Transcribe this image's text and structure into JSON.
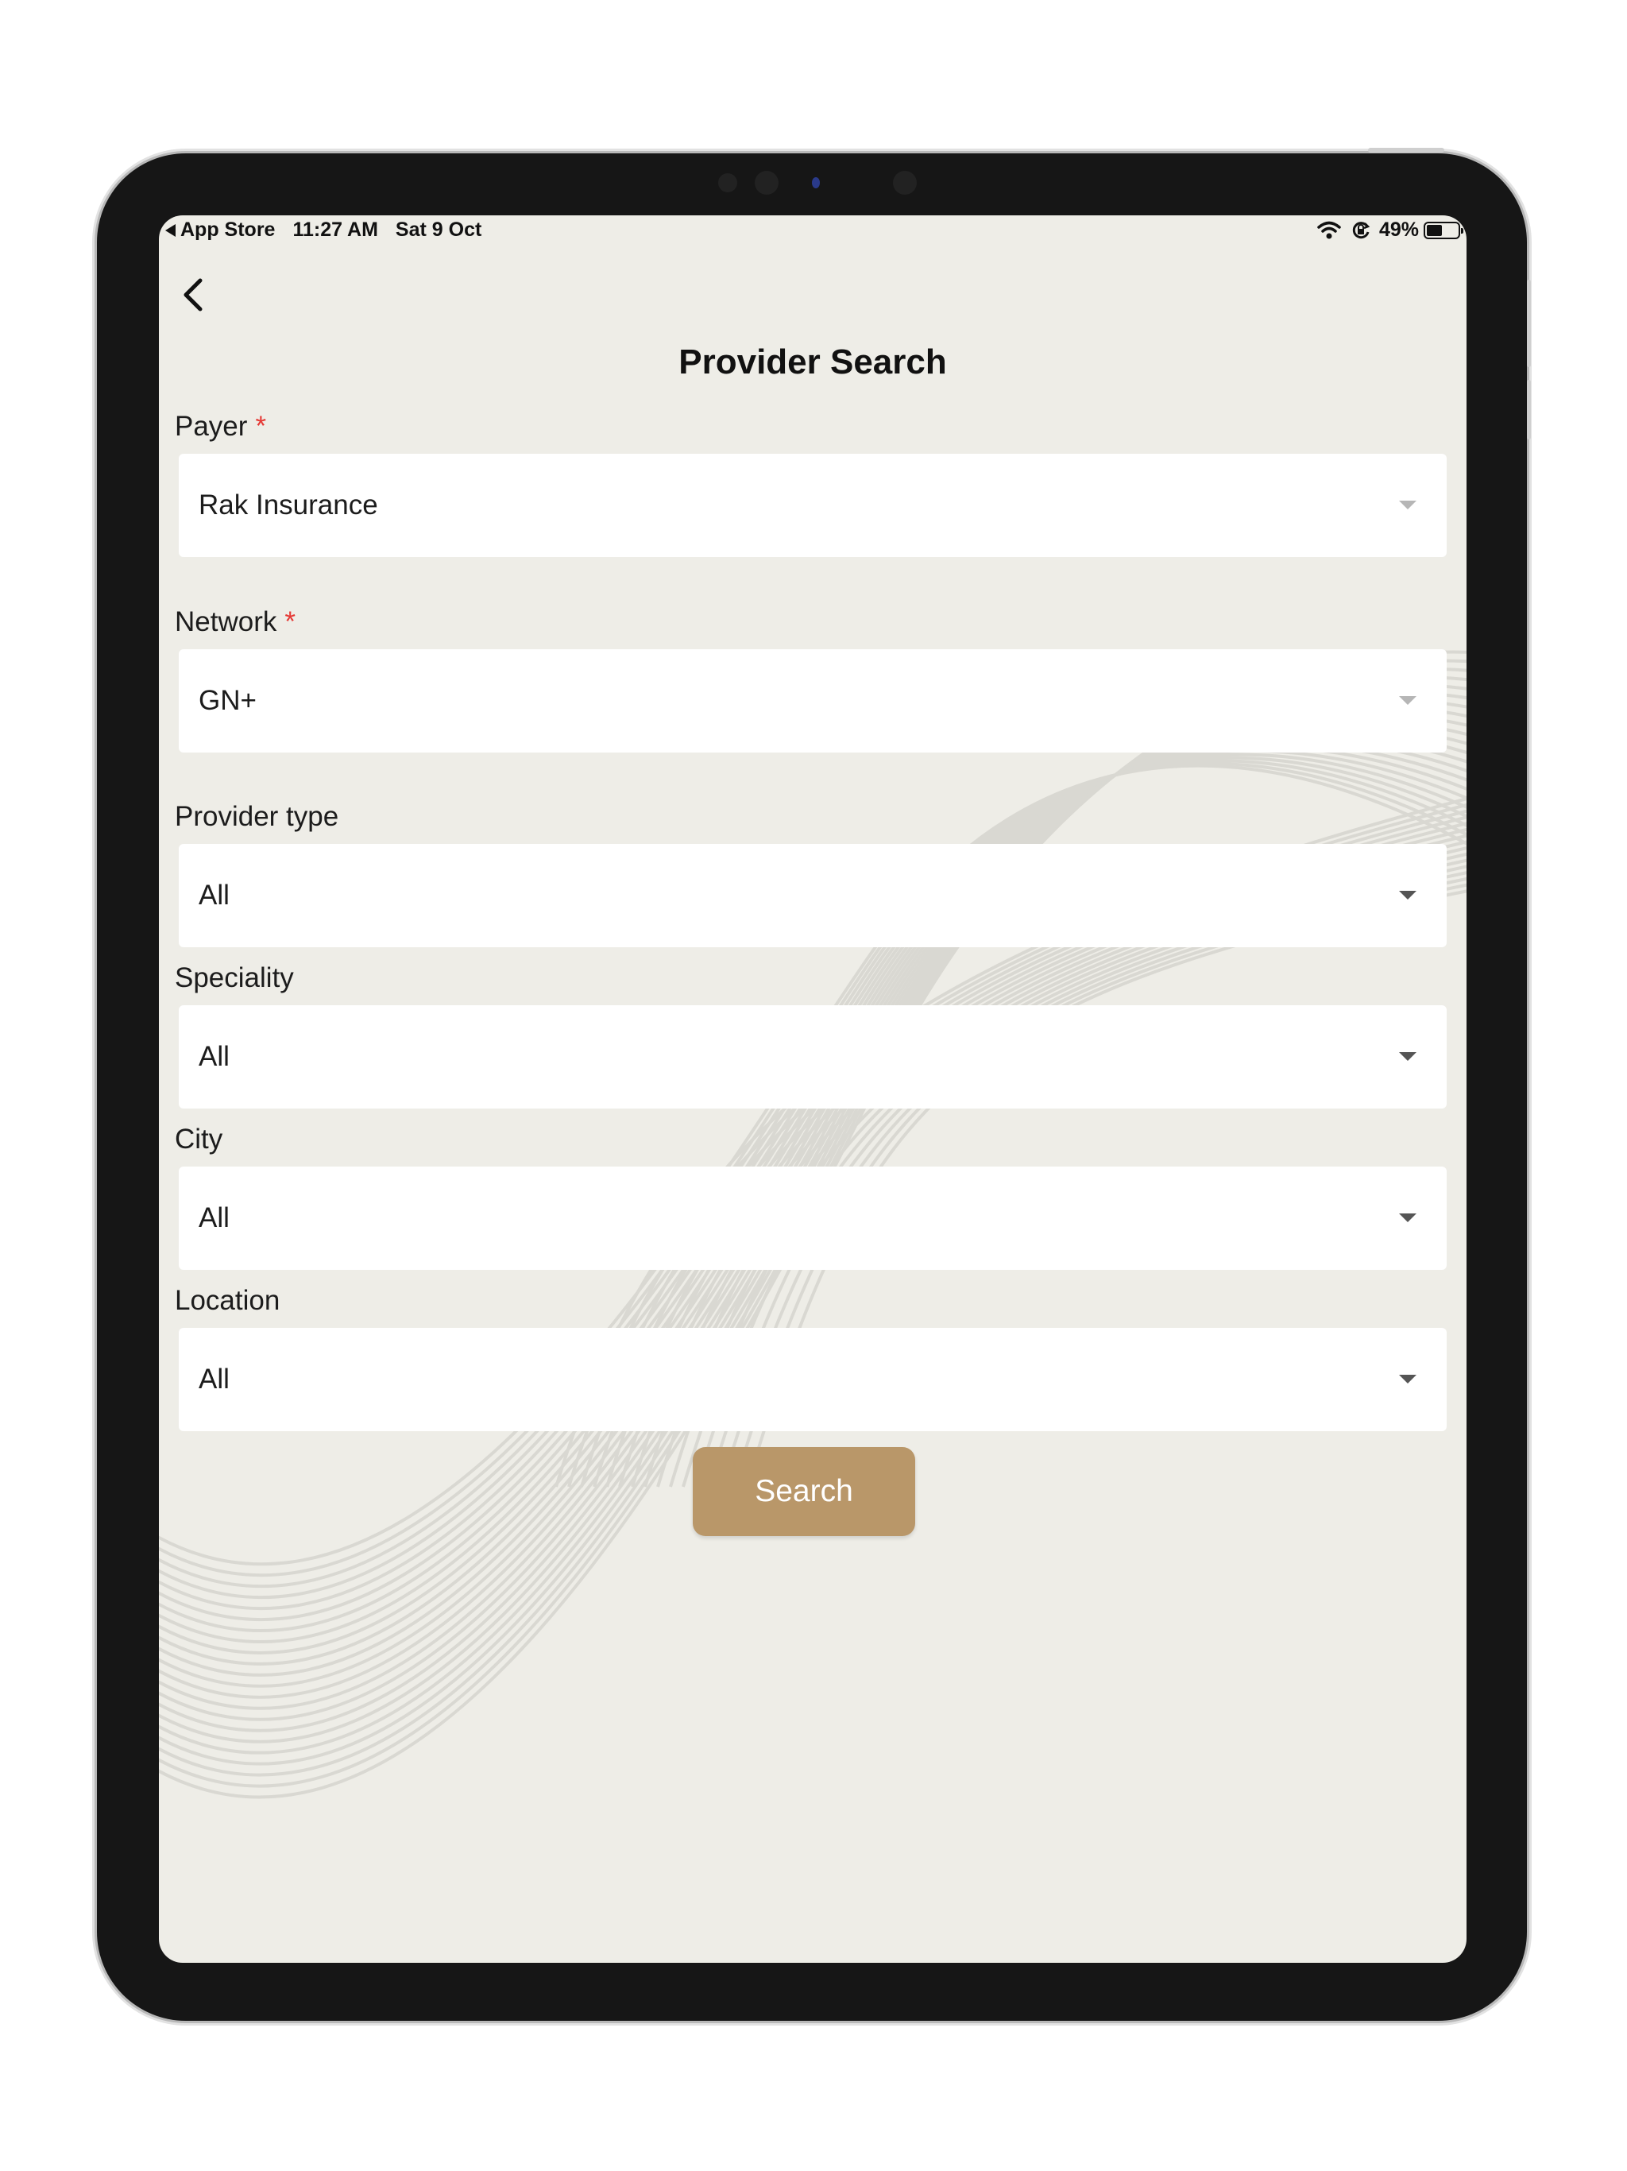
{
  "status_bar": {
    "back_app": "App Store",
    "time": "11:27 AM",
    "date": "Sat 9 Oct",
    "battery": "49%",
    "battery_level": 0.49,
    "icons": [
      "wifi-icon",
      "orientation-lock-icon",
      "battery-icon"
    ]
  },
  "header": {
    "back_icon": "chevron-left-icon",
    "title": "Provider Search"
  },
  "form": {
    "required_mark": "*",
    "payer": {
      "label": "Payer",
      "value": "Rak Insurance",
      "required": true
    },
    "network": {
      "label": "Network",
      "value": "GN+",
      "required": true
    },
    "provider_type": {
      "label": "Provider type",
      "value": "All"
    },
    "speciality": {
      "label": "Speciality",
      "value": "All"
    },
    "city": {
      "label": "City",
      "value": "All"
    },
    "location": {
      "label": "Location",
      "value": "All"
    },
    "search_label": "Search"
  },
  "colors": {
    "background": "#eeede7",
    "accent": "#b99769",
    "required": "#e53935",
    "frame": "#161616"
  }
}
